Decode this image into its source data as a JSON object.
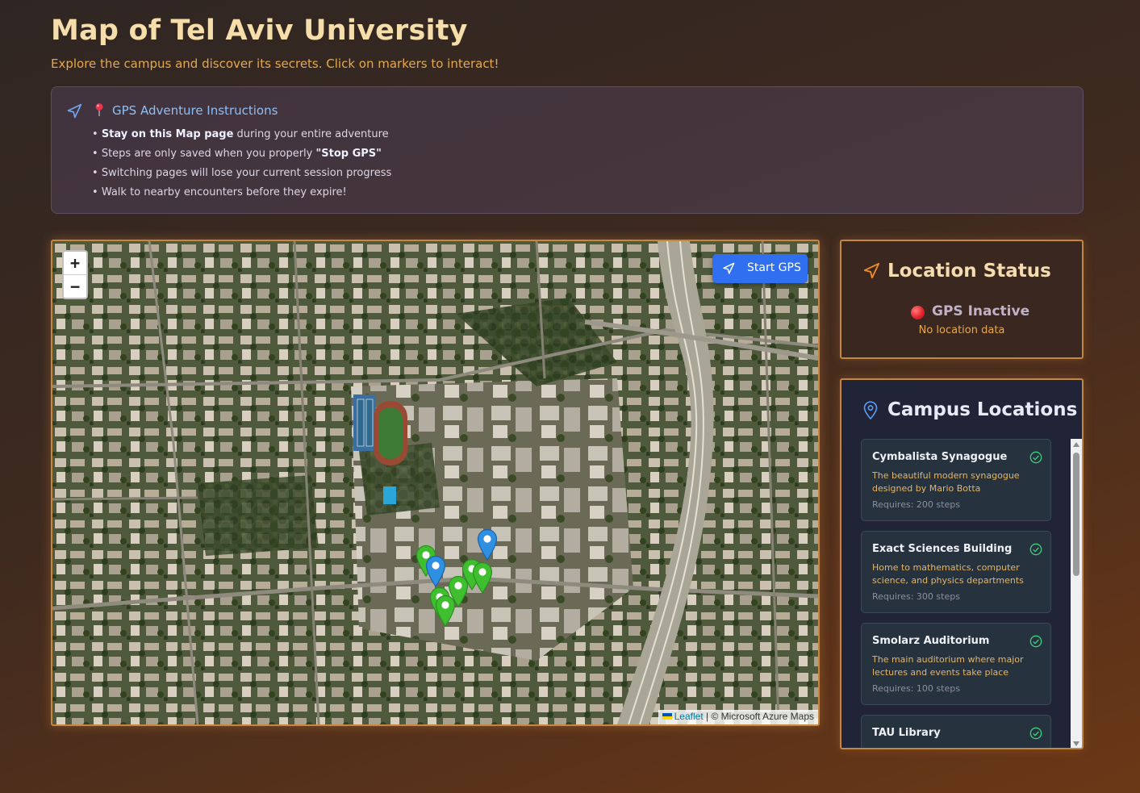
{
  "header": {
    "title": "Map of Tel Aviv University",
    "subtitle": "Explore the campus and discover its secrets. Click on markers to interact!"
  },
  "instructions": {
    "title": "GPS Adventure Instructions",
    "items": [
      {
        "bold": "Stay on this Map page",
        "rest": " during your entire adventure"
      },
      {
        "pre": "Steps are only saved when you properly ",
        "bold": "\"Stop GPS\""
      },
      {
        "text": "Switching pages will lose your current session progress"
      },
      {
        "text": "Walk to nearby encounters before they expire!"
      }
    ],
    "bullet": "•"
  },
  "map": {
    "zoom_in": "+",
    "zoom_out": "−",
    "gps_button": "Start GPS",
    "attribution_link": "Leaflet",
    "attribution_text": " | © Microsoft Azure Maps",
    "markers": [
      {
        "color": "green",
        "icon": "map-pin"
      },
      {
        "color": "blue",
        "icon": "map-pin"
      },
      {
        "color": "blue",
        "icon": "map-pin"
      },
      {
        "color": "green",
        "icon": "map-pin"
      },
      {
        "color": "green",
        "icon": "map-pin"
      },
      {
        "color": "green",
        "icon": "map-pin"
      },
      {
        "color": "green",
        "icon": "map-pin"
      },
      {
        "color": "green",
        "icon": "map-pin"
      }
    ]
  },
  "location_status": {
    "title": "Location Status",
    "state": "GPS Inactive",
    "detail": "No location data"
  },
  "campus_locations": {
    "title": "Campus Locations",
    "items": [
      {
        "name": "Cymbalista Synagogue",
        "desc": "The beautiful modern synagogue designed by Mario Botta",
        "req": "Requires: 200 steps"
      },
      {
        "name": "Exact Sciences Building",
        "desc": "Home to mathematics, computer science, and physics departments",
        "req": "Requires: 300 steps"
      },
      {
        "name": "Smolarz Auditorium",
        "desc": "The main auditorium where major lectures and events take place",
        "req": "Requires: 100 steps"
      },
      {
        "name": "TAU Library",
        "desc": "",
        "req": ""
      }
    ]
  },
  "colors": {
    "accent_gold": "#c38742",
    "gps_blue": "#2f6ff0",
    "marker_green": "#3fbf2f",
    "marker_blue": "#2f8fe0",
    "status_red": "#e0202a"
  }
}
